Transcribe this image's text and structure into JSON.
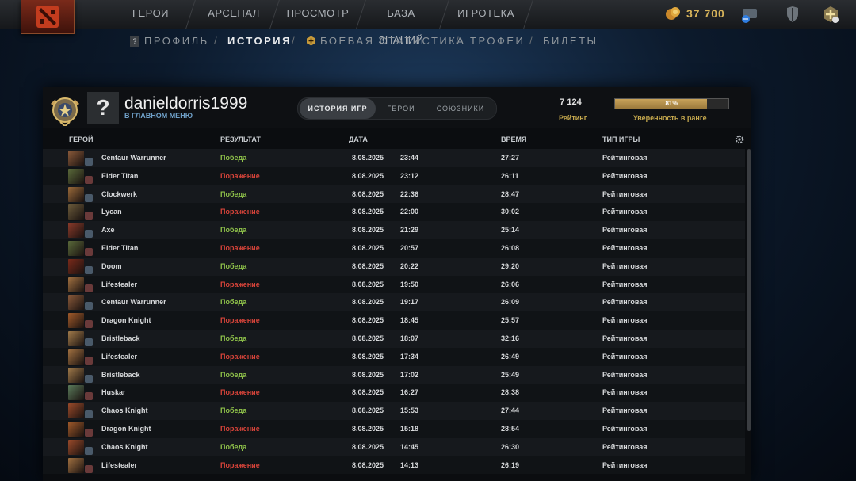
{
  "nav": {
    "items": [
      "ГЕРОИ",
      "АРСЕНАЛ",
      "ПРОСМОТР",
      "БАЗА ЗНАНИЙ",
      "ИГРОТЕКА"
    ],
    "gold": "37 700"
  },
  "subnav": {
    "items": [
      "ПРОФИЛЬ",
      "ИСТОРИЯ",
      "БОЕВАЯ СТАТИСТИКА",
      "ТРОФЕИ",
      "БИЛЕТЫ"
    ],
    "active": "ИСТОРИЯ"
  },
  "profile": {
    "avatar_glyph": "?",
    "username": "danieldorris1999",
    "status": "В ГЛАВНОМ МЕНЮ",
    "tabs": [
      "ИСТОРИЯ ИГР",
      "ГЕРОИ",
      "СОЮЗНИКИ"
    ],
    "mmr": "7 124",
    "mmr_label": "Рейтинг",
    "confidence": "81%",
    "confidence_value": 81,
    "confidence_label": "Уверенность в ранге"
  },
  "table": {
    "headers": {
      "hero": "ГЕРОЙ",
      "result": "РЕЗУЛЬТАТ",
      "date": "ДАТА",
      "duration": "ВРЕМЯ",
      "type": "ТИП ИГРЫ"
    },
    "rows": [
      {
        "hero": "Centaur Warrunner",
        "result": "Победа",
        "win": true,
        "date": "8.08.2025",
        "time": "23:44",
        "duration": "27:27",
        "type": "Рейтинговая",
        "color": "#8a5a3a"
      },
      {
        "hero": "Elder Titan",
        "result": "Поражение",
        "win": false,
        "date": "8.08.2025",
        "time": "23:12",
        "duration": "26:11",
        "type": "Рейтинговая",
        "color": "#5a6a3a"
      },
      {
        "hero": "Clockwerk",
        "result": "Победа",
        "win": true,
        "date": "8.08.2025",
        "time": "22:36",
        "duration": "28:47",
        "type": "Рейтинговая",
        "color": "#9a6a3a"
      },
      {
        "hero": "Lycan",
        "result": "Поражение",
        "win": false,
        "date": "8.08.2025",
        "time": "22:00",
        "duration": "30:02",
        "type": "Рейтинговая",
        "color": "#6a5a3a"
      },
      {
        "hero": "Axe",
        "result": "Победа",
        "win": true,
        "date": "8.08.2025",
        "time": "21:29",
        "duration": "25:14",
        "type": "Рейтинговая",
        "color": "#8a3a2a"
      },
      {
        "hero": "Elder Titan",
        "result": "Поражение",
        "win": false,
        "date": "8.08.2025",
        "time": "20:57",
        "duration": "26:08",
        "type": "Рейтинговая",
        "color": "#5a6a3a"
      },
      {
        "hero": "Doom",
        "result": "Победа",
        "win": true,
        "date": "8.08.2025",
        "time": "20:22",
        "duration": "29:20",
        "type": "Рейтинговая",
        "color": "#7a2a1a"
      },
      {
        "hero": "Lifestealer",
        "result": "Поражение",
        "win": false,
        "date": "8.08.2025",
        "time": "19:50",
        "duration": "26:06",
        "type": "Рейтинговая",
        "color": "#a07040"
      },
      {
        "hero": "Centaur Warrunner",
        "result": "Победа",
        "win": true,
        "date": "8.08.2025",
        "time": "19:17",
        "duration": "26:09",
        "type": "Рейтинговая",
        "color": "#8a5a3a"
      },
      {
        "hero": "Dragon Knight",
        "result": "Поражение",
        "win": false,
        "date": "8.08.2025",
        "time": "18:45",
        "duration": "25:57",
        "type": "Рейтинговая",
        "color": "#a05a2a"
      },
      {
        "hero": "Bristleback",
        "result": "Победа",
        "win": true,
        "date": "8.08.2025",
        "time": "18:07",
        "duration": "32:16",
        "type": "Рейтинговая",
        "color": "#a07a4a"
      },
      {
        "hero": "Lifestealer",
        "result": "Поражение",
        "win": false,
        "date": "8.08.2025",
        "time": "17:34",
        "duration": "26:49",
        "type": "Рейтинговая",
        "color": "#a07040"
      },
      {
        "hero": "Bristleback",
        "result": "Победа",
        "win": true,
        "date": "8.08.2025",
        "time": "17:02",
        "duration": "25:49",
        "type": "Рейтинговая",
        "color": "#a07a4a"
      },
      {
        "hero": "Huskar",
        "result": "Поражение",
        "win": false,
        "date": "8.08.2025",
        "time": "16:27",
        "duration": "28:38",
        "type": "Рейтинговая",
        "color": "#5a7a5a"
      },
      {
        "hero": "Chaos Knight",
        "result": "Победа",
        "win": true,
        "date": "8.08.2025",
        "time": "15:53",
        "duration": "27:44",
        "type": "Рейтинговая",
        "color": "#9a4a2a"
      },
      {
        "hero": "Dragon Knight",
        "result": "Поражение",
        "win": false,
        "date": "8.08.2025",
        "time": "15:18",
        "duration": "28:54",
        "type": "Рейтинговая",
        "color": "#a05a2a"
      },
      {
        "hero": "Chaos Knight",
        "result": "Победа",
        "win": true,
        "date": "8.08.2025",
        "time": "14:45",
        "duration": "26:30",
        "type": "Рейтинговая",
        "color": "#9a4a2a"
      },
      {
        "hero": "Lifestealer",
        "result": "Поражение",
        "win": false,
        "date": "8.08.2025",
        "time": "14:13",
        "duration": "26:19",
        "type": "Рейтинговая",
        "color": "#a07040"
      }
    ]
  },
  "colors": {
    "win": "#8fc24a",
    "loss": "#d9443a",
    "gold": "#c6a94e"
  }
}
